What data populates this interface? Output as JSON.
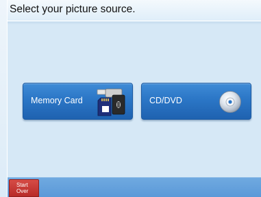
{
  "header": {
    "title": "Select your picture source."
  },
  "sources": [
    {
      "label": "Memory Card",
      "icon": "memory-card-icon"
    },
    {
      "label": "CD/DVD",
      "icon": "disc-icon"
    }
  ],
  "footer": {
    "start_over_label": "Start\nOver"
  },
  "colors": {
    "button_blue": "#2b76c6",
    "screen_bg": "#d6e8f6",
    "start_over_red": "#c0312e"
  }
}
